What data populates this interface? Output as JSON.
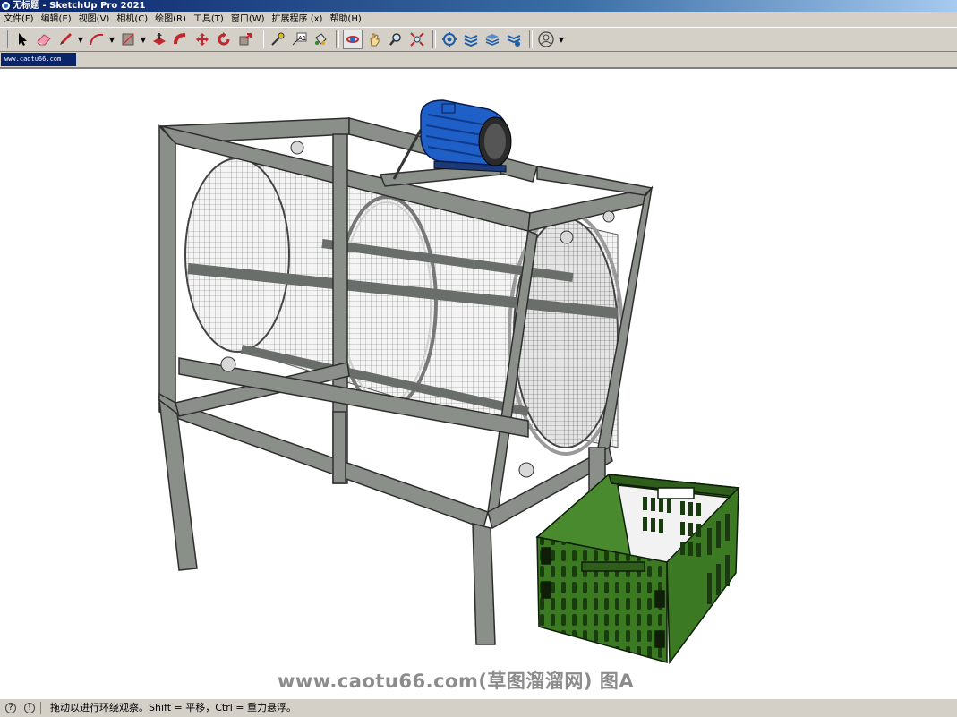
{
  "window": {
    "title": "无标题 - SketchUp Pro 2021"
  },
  "menu": [
    "文件(F)",
    "编辑(E)",
    "视图(V)",
    "相机(C)",
    "绘图(R)",
    "工具(T)",
    "窗口(W)",
    "扩展程序 (x)",
    "帮助(H)"
  ],
  "tab": {
    "label": "www.caotu66.com"
  },
  "watermark": "www.caotu66.com(草图溜溜网) 图A",
  "status": {
    "message": "拖动以进行环绕观察。Shift = 平移，Ctrl = 重力悬浮。"
  },
  "toolbar": {
    "tools": [
      "select-icon",
      "eraser-icon",
      "pencil-icon",
      "arc-icon",
      "rectangle-icon",
      "push-pull-icon",
      "follow-me-icon",
      "move-icon",
      "rotate-icon",
      "scale-icon",
      "tape-measure-icon",
      "text-icon",
      "paint-bucket-icon",
      "orbit-icon",
      "pan-icon",
      "zoom-icon",
      "zoom-extents-icon",
      "3d-warehouse-icon",
      "extension-warehouse-icon",
      "layout-icon",
      "extension-manager-icon",
      "account-icon"
    ],
    "active": "orbit-icon"
  },
  "colors": {
    "titlebar": "#0a246a",
    "frame": "#8a8f8a",
    "motor": "#1f5fc8",
    "crate": "#3b7a22"
  }
}
